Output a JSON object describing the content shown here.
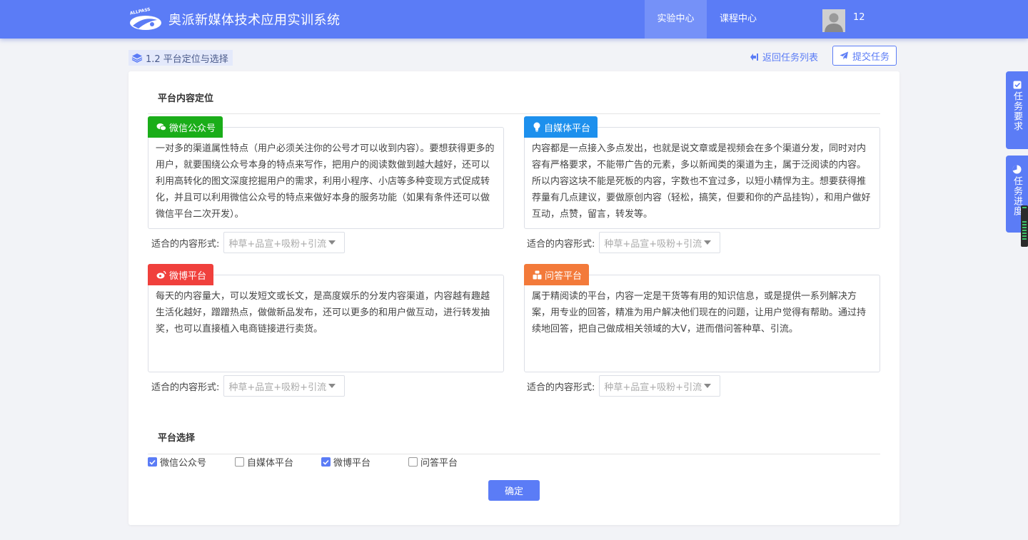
{
  "header": {
    "logo_text": "ALLPASS",
    "app_title": "奥派新媒体技术应用实训系统",
    "nav": [
      {
        "label": "实验中心",
        "active": true
      },
      {
        "label": "课程中心",
        "active": false
      }
    ],
    "username": "12"
  },
  "subbar": {
    "breadcrumb": "1.2 平台定位与选择",
    "back_label": "返回任务列表",
    "submit_label": "提交任务"
  },
  "content": {
    "section1_title": "平台内容定位",
    "form_label": "适合的内容形式:",
    "platforms": [
      {
        "name": "微信公众号",
        "icon": "wechat-icon",
        "color": "#1aad19",
        "description": "一对多的渠道属性特点（用户必须关注你的公号才可以收到内容）。要想获得更多的用户，就要围绕公众号本身的特点来写作，把用户的阅读数做到越大越好，还可以利用高转化的图文深度挖掘用户的需求，利用小程序、小店等多种变现方式促成转化，并且可以利用微信公众号的特点来做好本身的服务功能（如果有条件还可以做微信平台二次开发）。",
        "select_value": "种草+品宣+吸粉+引流"
      },
      {
        "name": "自媒体平台",
        "icon": "bulb-icon",
        "color": "#1d90ed",
        "description": "内容都是一点接入多点发出，也就是说文章或是视频会在多个渠道分发，同时对内容有严格要求，不能带广告的元素，多以新闻类的渠道为主，属于泛阅读的内容。所以内容这块不能是死板的内容，字数也不宜过多，以短小精悍为主。想要获得推荐量有几点建议，要做原创内容（轻松，搞笑，但要和你的产品挂钩），和用户做好互动，点赞，留言，转发等。",
        "select_value": "种草+品宣+吸粉+引流"
      },
      {
        "name": "微博平台",
        "icon": "weibo-icon",
        "color": "#f0403c",
        "description": "每天的内容量大，可以发短文或长文，是高度娱乐的分发内容渠道，内容越有趣越生活化越好，蹭蹭热点，做做新品发布，还可以更多的和用户做互动，进行转发抽奖，也可以直接植入电商链接进行卖货。",
        "select_value": "种草+品宣+吸粉+引流"
      },
      {
        "name": "问答平台",
        "icon": "qa-icon",
        "color": "#f37a3a",
        "description": "属于精阅读的平台，内容一定是干货等有用的知识信息，或是提供一系列解决方案，用专业的回答，精准为用户解决他们现在的问题，让用户觉得有帮助。通过持续地回答，把自己做成相关领域的大V，进而借问答种草、引流。",
        "select_value": "种草+品宣+吸粉+引流"
      }
    ],
    "section2_title": "平台选择",
    "checkboxes": [
      {
        "label": "微信公众号",
        "checked": true
      },
      {
        "label": "自媒体平台",
        "checked": false
      },
      {
        "label": "微博平台",
        "checked": true
      },
      {
        "label": "问答平台",
        "checked": false
      }
    ],
    "confirm_label": "确定"
  },
  "side": {
    "task_requirements": "任务要求",
    "task_progress": "任务进度"
  }
}
